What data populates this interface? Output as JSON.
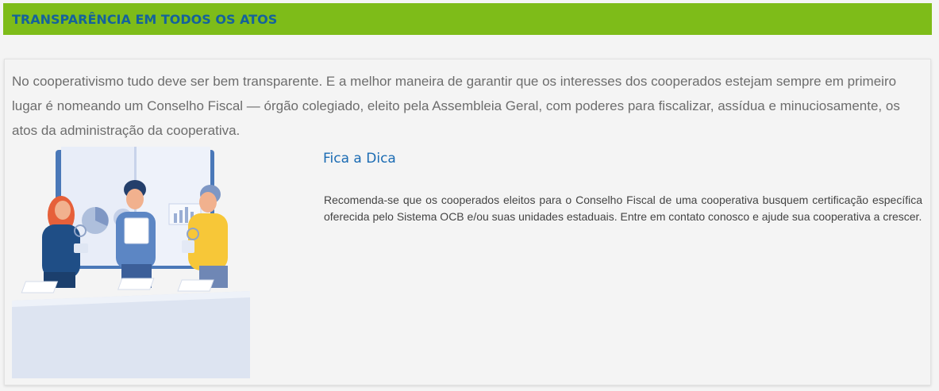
{
  "header": {
    "title": "TRANSPARÊNCIA EM TODOS OS ATOS",
    "background_color": "#7ebc19",
    "title_color": "#14629c"
  },
  "intro": {
    "text": "No cooperativismo tudo deve ser bem transparente. E a melhor maneira de garantir que os interesses dos cooperados estejam sempre em primeiro lugar é nomeando um Conselho Fiscal — órgão colegiado, eleito pela Assembleia Geral, com poderes para fiscalizar, assídua e minuciosamente, os atos da administração da cooperativa."
  },
  "illustration": {
    "icon": "team-meeting-illustration"
  },
  "tip": {
    "title": "Fica a Dica",
    "text": "Recomenda-se que os cooperados eleitos para o Conselho Fiscal de uma cooperativa busquem certificação específica oferecida pelo Sistema OCB e/ou suas unidades estaduais. Entre em contato conosco e ajude sua cooperativa a crescer.",
    "title_color": "#1a6bb3"
  }
}
